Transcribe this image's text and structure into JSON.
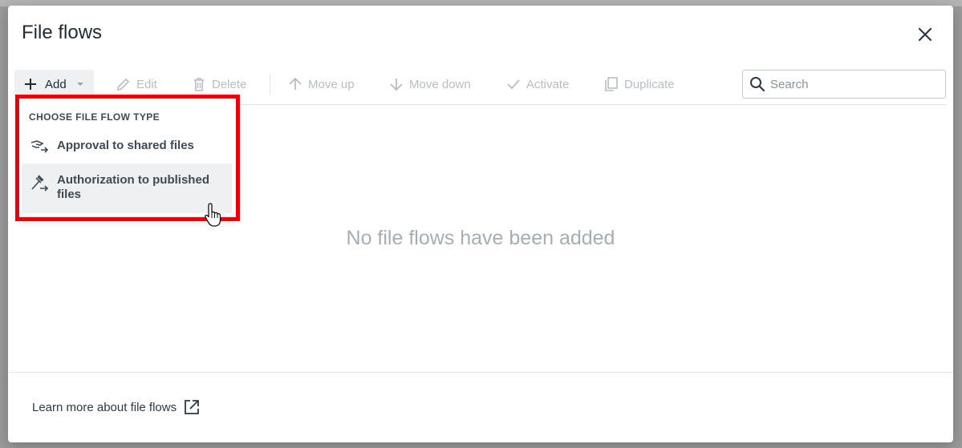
{
  "modal": {
    "title": "File flows"
  },
  "toolbar": {
    "add_label": "Add",
    "edit_label": "Edit",
    "delete_label": "Delete",
    "move_up_label": "Move up",
    "move_down_label": "Move down",
    "activate_label": "Activate",
    "duplicate_label": "Duplicate",
    "search_placeholder": "Search"
  },
  "dropdown": {
    "header": "CHOOSE FILE FLOW TYPE",
    "items": [
      {
        "label": "Approval to shared files",
        "icon": "approval-flow-icon"
      },
      {
        "label": "Authorization to published files",
        "icon": "authorization-flow-icon"
      }
    ]
  },
  "main": {
    "empty_message": "No file flows have been added"
  },
  "footer": {
    "learn_more_label": "Learn more about file flows"
  },
  "colors": {
    "highlight": "#e8000a",
    "disabled_text": "#b7bdc2",
    "text": "#1f2a33"
  }
}
